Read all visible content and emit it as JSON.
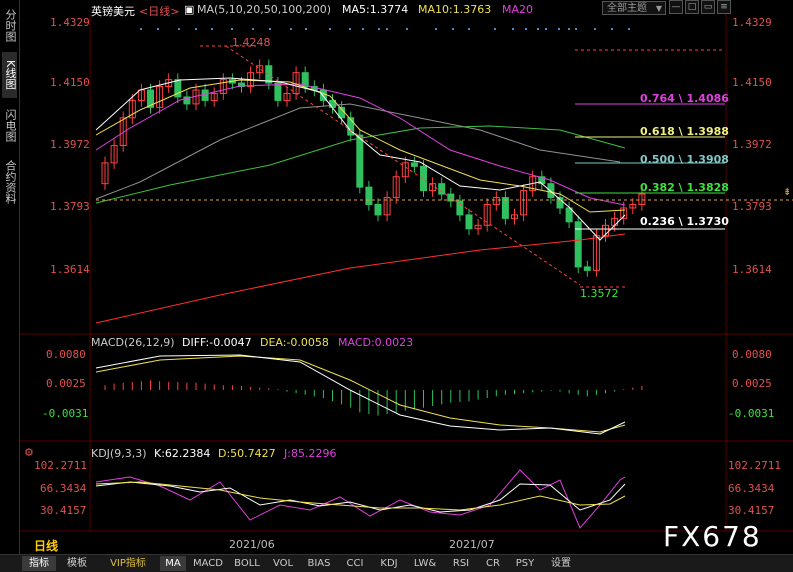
{
  "sidebar": {
    "tabs": [
      {
        "label": "分时图",
        "active": false
      },
      {
        "label": "K线图",
        "active": true
      },
      {
        "label": "闪电图",
        "active": false
      },
      {
        "label": "合约资料",
        "active": false
      }
    ]
  },
  "header": {
    "symbol": "英镑美元",
    "period": "<日线>",
    "ma_params": "MA(5,10,20,50,100,200)",
    "ma5": "MA5:1.3774",
    "ma10": "MA10:1.3763",
    "ma20": "MA20",
    "theme_label": "全部主题",
    "colors": {
      "symbol": "#ffffff",
      "period": "#e05050",
      "ma5": "#ffffff",
      "ma10": "#f0e050",
      "ma20": "#e040e0"
    }
  },
  "price_axis": {
    "left": [
      "1.4329",
      "1.4150",
      "1.3972",
      "1.3793",
      "1.3614"
    ],
    "right": [
      "1.4329",
      "1.4150",
      "1.3972",
      "1.3793",
      "1.3614"
    ]
  },
  "annotations": {
    "high": "1.4248",
    "low": "1.3572"
  },
  "fib_levels": [
    {
      "text": "0.764 \\ 1.4086",
      "color": "#e040e0"
    },
    {
      "text": "0.618 \\ 1.3988",
      "color": "#f0f080"
    },
    {
      "text": "0.500 \\ 1.3908",
      "color": "#80c8c8"
    },
    {
      "text": "0.382 \\ 1.3828",
      "color": "#40e040"
    },
    {
      "text": "0.236 \\ 1.3730",
      "color": "#ffffff"
    }
  ],
  "macd": {
    "title": "MACD(26,12,9)",
    "diff": "DIFF:-0.0047",
    "dea": "DEA:-0.0058",
    "macd": "MACD:0.0023",
    "axis": [
      "0.0080",
      "0.0025",
      "-0.0031"
    ]
  },
  "kdj": {
    "title": "KDJ(9,3,3)",
    "k": "K:62.2384",
    "d": "D:50.7427",
    "j": "J:85.2296",
    "axis": [
      "102.2711",
      "66.3434",
      "30.4157"
    ]
  },
  "dates": [
    "2021/06",
    "2021/07"
  ],
  "period_label": "日线",
  "watermark": "FX678",
  "bottom_tabs": [
    {
      "label": "指标",
      "active": true,
      "vip": false
    },
    {
      "label": "模板",
      "active": false,
      "vip": false
    },
    {
      "label": "VIP指标",
      "active": false,
      "vip": true
    },
    {
      "label": "MA",
      "active": true,
      "vip": false
    },
    {
      "label": "MACD",
      "active": false,
      "vip": false
    },
    {
      "label": "BOLL",
      "active": false,
      "vip": false
    },
    {
      "label": "VOL",
      "active": false,
      "vip": false
    },
    {
      "label": "BIAS",
      "active": false,
      "vip": false
    },
    {
      "label": "CCI",
      "active": false,
      "vip": false
    },
    {
      "label": "KDJ",
      "active": false,
      "vip": false
    },
    {
      "label": "LW&",
      "active": false,
      "vip": false
    },
    {
      "label": "RSI",
      "active": false,
      "vip": false
    },
    {
      "label": "CR",
      "active": false,
      "vip": false
    },
    {
      "label": "PSY",
      "active": false,
      "vip": false
    },
    {
      "label": "设置",
      "active": false,
      "vip": false
    }
  ]
}
